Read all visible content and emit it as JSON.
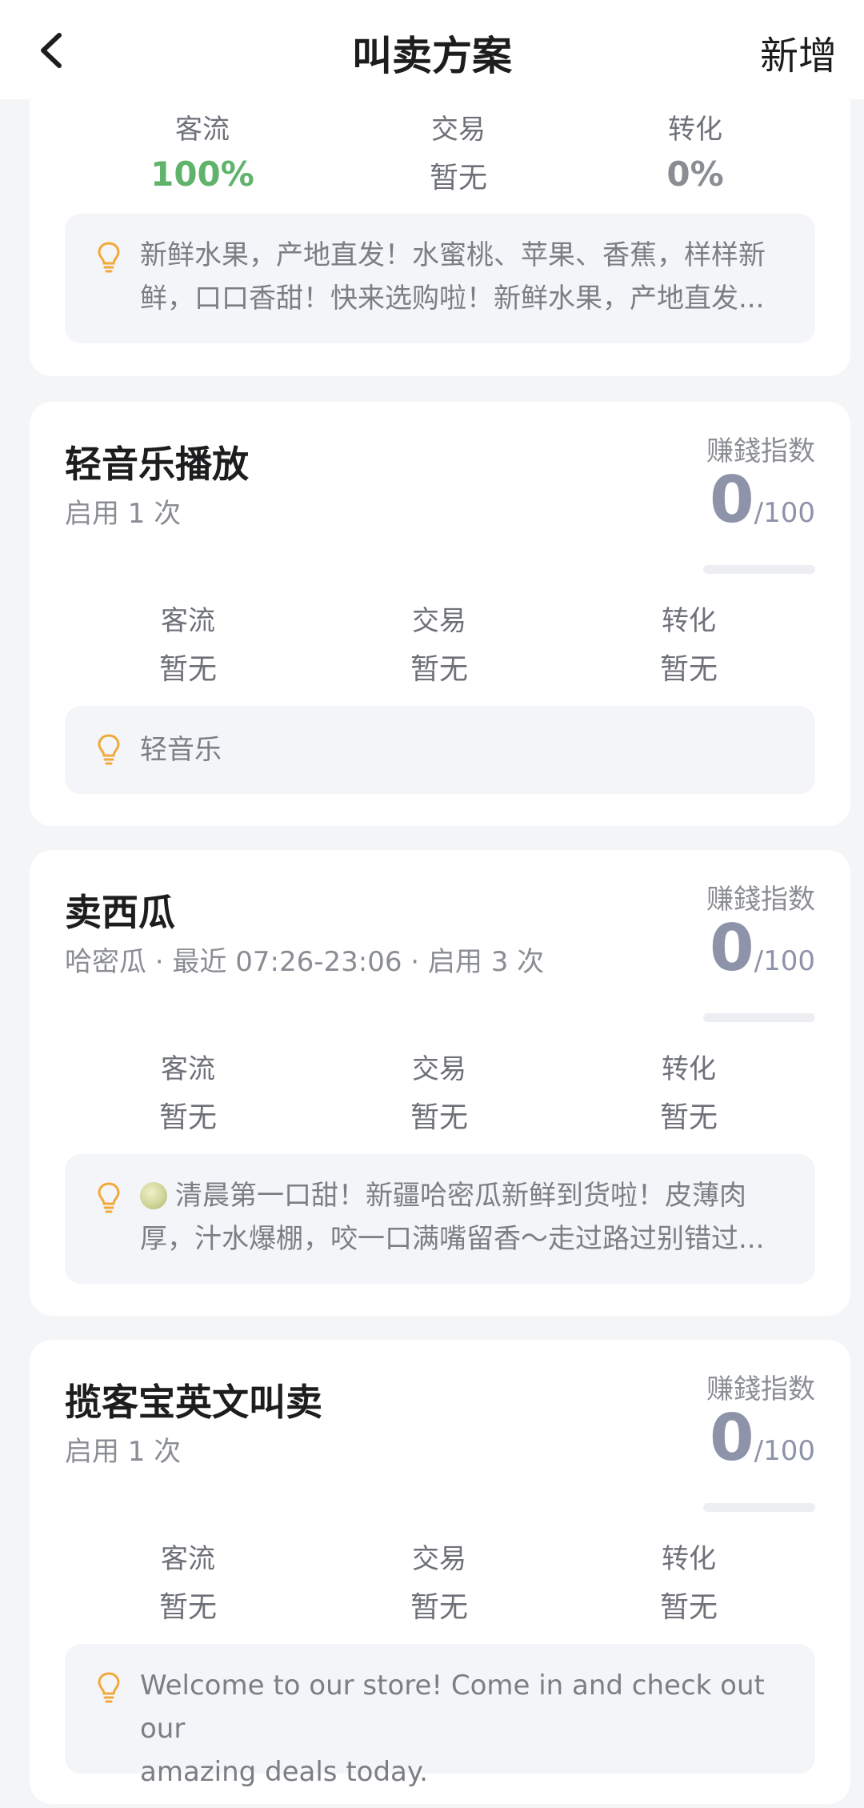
{
  "navbar": {
    "title": "叫卖方案",
    "add_label": "新增"
  },
  "cards": [
    {
      "metrics": [
        {
          "label": "客流",
          "value": "100%"
        },
        {
          "label": "交易",
          "value": "暂无"
        },
        {
          "label": "转化",
          "value": "0%"
        }
      ],
      "hint_line1": "新鲜水果，产地直发！水蜜桃、苹果、香蕉，样样新",
      "hint_line2": "鲜，口口香甜！快来选购啦！新鲜水果，产地直发..."
    },
    {
      "title": "轻音乐播放",
      "subtitle": "启用 1 次",
      "score_label": "赚錢指数",
      "score": "0",
      "score_max": "/100",
      "metrics": [
        {
          "label": "客流",
          "value": "暂无"
        },
        {
          "label": "交易",
          "value": "暂无"
        },
        {
          "label": "转化",
          "value": "暂无"
        }
      ],
      "hint_line1": "轻音乐"
    },
    {
      "title": "卖西瓜",
      "subtitle": "哈密瓜 · 最近 07:26-23:06 · 启用 3 次",
      "score_label": "赚錢指数",
      "score": "0",
      "score_max": "/100",
      "metrics": [
        {
          "label": "客流",
          "value": "暂无"
        },
        {
          "label": "交易",
          "value": "暂无"
        },
        {
          "label": "转化",
          "value": "暂无"
        }
      ],
      "hint_line1": "清晨第一口甜！新疆哈密瓜新鲜到货啦！皮薄肉",
      "hint_line2": "厚，汁水爆棚，咬一口满嘴留香～走过路过别错过..."
    },
    {
      "title": "揽客宝英文叫卖",
      "subtitle": "启用 1 次",
      "score_label": "赚錢指数",
      "score": "0",
      "score_max": "/100",
      "metrics": [
        {
          "label": "客流",
          "value": "暂无"
        },
        {
          "label": "交易",
          "value": "暂无"
        },
        {
          "label": "转化",
          "value": "暂无"
        }
      ],
      "hint_line1": "Welcome to our store! Come in and check out our",
      "hint_line2": "amazing deals today."
    }
  ],
  "colors": {
    "traffic_positive": "#5fb36b",
    "bulb": "#f0a93a"
  },
  "icons": {
    "back": "chevron-left-icon",
    "hint": "lightbulb-icon",
    "melon": "melon-emoji-icon"
  }
}
